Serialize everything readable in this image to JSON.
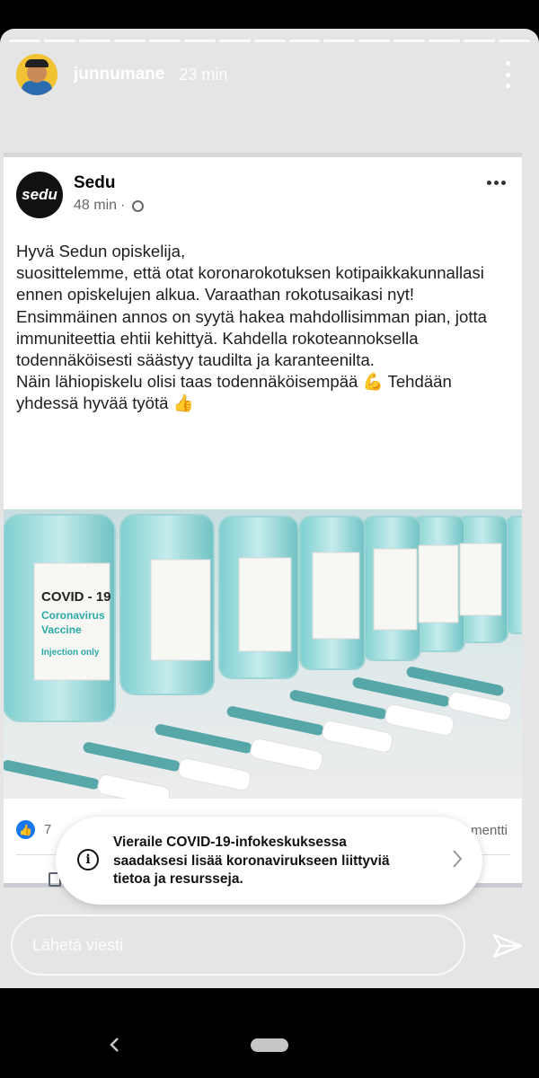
{
  "story": {
    "username": "junnumane",
    "time_ago": "23 min",
    "progress_segments": 15,
    "reply_placeholder": "Lähetä viesti"
  },
  "post": {
    "page_name": "Sedu",
    "logo_text": "sedu",
    "time": "48 min",
    "separator": "·",
    "text": "Hyvä Sedun opiskelija,\nsuosittelemme, että otat koronarokotuksen kotipaikkakunnallasi ennen opiskelujen alkua. Varaathan rokotusaikasi nyt!\nEnsimmäinen annos on syytä hakea mahdollisimman pian, jotta immuniteettia ehtii kehittyä. Kahdella rokoteannoksella todennäköisesti säästyy taudilta ja karanteenilta.\nNäin lähiopiskelu olisi taas todennäköisempää 💪 Tehdään yhdessä hyvää työtä 👍",
    "image": {
      "vial_label_title": "COVID - 19",
      "vial_label_line1": "Coronavirus",
      "vial_label_line2": "Vaccine",
      "vial_label_line3": "Injection only"
    },
    "like_count": "7",
    "comments_text": "mentti"
  },
  "covid_banner": {
    "text": "Vieraile COVID-19-infokeskuksessa saadaksesi lisää koronavirukseen liittyviä tietoa ja resursseja."
  },
  "colors": {
    "story_bg": "#e5e5e5",
    "like_blue": "#1877f2",
    "vial_teal": "#2aa9a8"
  }
}
